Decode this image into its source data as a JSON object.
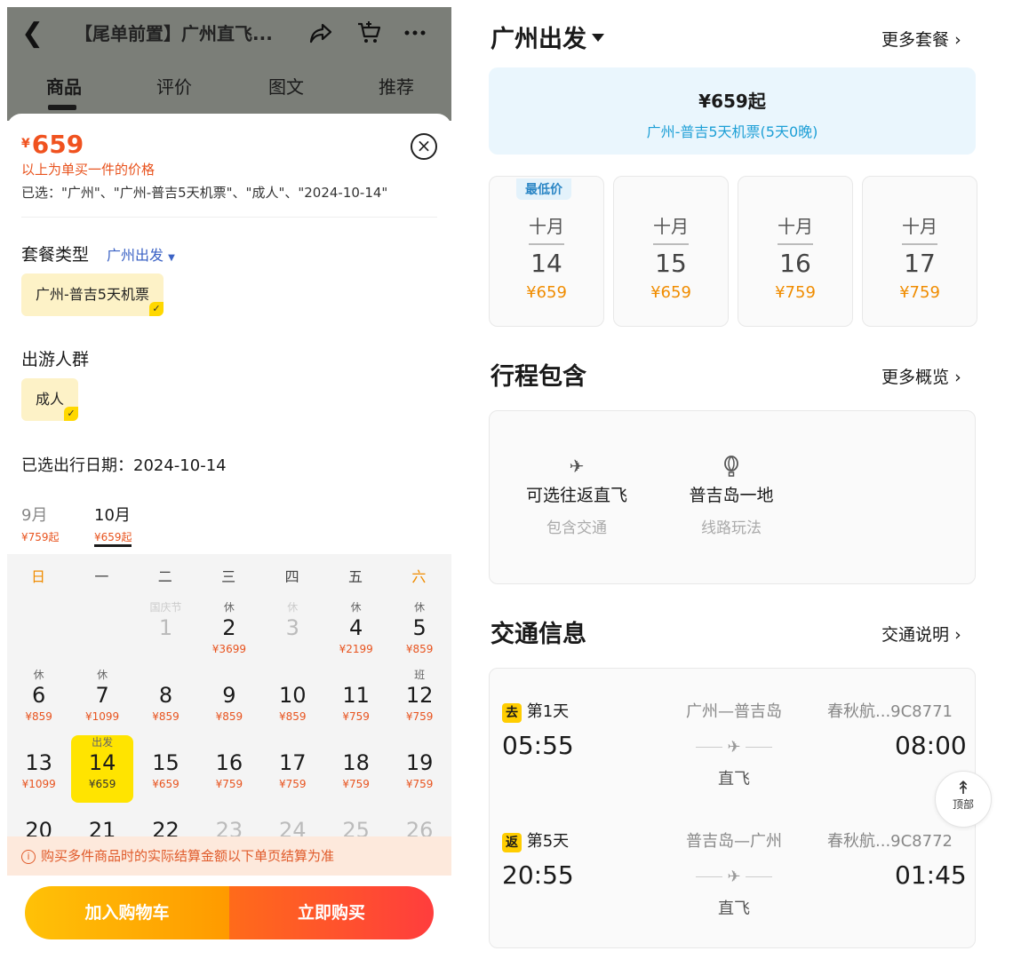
{
  "left": {
    "title": "【尾单前置】广州直飞...",
    "tabs": [
      "商品",
      "评价",
      "图文",
      "推荐"
    ],
    "price_currency": "¥",
    "price": "659",
    "price_note": "以上为单买一件的价格",
    "selected": "已选：\"广州\"、\"广州-普吉5天机票\"、\"成人\"、\"2024-10-14\"",
    "package_label": "套餐类型",
    "package_link": "广州出发",
    "package_chip": "广州-普吉5天机票",
    "crowd_label": "出游人群",
    "crowd_chip": "成人",
    "date_line": "已选出行日期：2024-10-14",
    "months": [
      {
        "name": "9月",
        "price": "¥759起"
      },
      {
        "name": "10月",
        "price": "¥659起"
      }
    ],
    "weekdays": [
      "日",
      "一",
      "二",
      "三",
      "四",
      "五",
      "六"
    ],
    "notice": "购买多件商品时的实际结算金额以下单页结算为准",
    "cart_button": "加入购物车",
    "buy_button": "立即购买"
  },
  "calendar": {
    "rows": [
      [
        {
          "tag": "",
          "num": "",
          "price": ""
        },
        {
          "tag": "",
          "num": "",
          "price": ""
        },
        {
          "tag": "国庆节",
          "num": "1",
          "price": "",
          "dim": true
        },
        {
          "tag": "休",
          "num": "2",
          "price": "¥3699"
        },
        {
          "tag": "休",
          "num": "3",
          "price": "",
          "dim": true
        },
        {
          "tag": "休",
          "num": "4",
          "price": "¥2199"
        },
        {
          "tag": "休",
          "num": "5",
          "price": "¥859"
        }
      ],
      [
        {
          "tag": "休",
          "num": "6",
          "price": "¥859"
        },
        {
          "tag": "休",
          "num": "7",
          "price": "¥1099"
        },
        {
          "tag": "",
          "num": "8",
          "price": "¥859"
        },
        {
          "tag": "",
          "num": "9",
          "price": "¥859"
        },
        {
          "tag": "",
          "num": "10",
          "price": "¥859"
        },
        {
          "tag": "",
          "num": "11",
          "price": "¥759"
        },
        {
          "tag": "班",
          "num": "12",
          "price": "¥759"
        }
      ],
      [
        {
          "tag": "",
          "num": "13",
          "price": "¥1099"
        },
        {
          "tag": "出发",
          "num": "14",
          "price": "¥659",
          "sel": true
        },
        {
          "tag": "",
          "num": "15",
          "price": "¥659"
        },
        {
          "tag": "",
          "num": "16",
          "price": "¥759"
        },
        {
          "tag": "",
          "num": "17",
          "price": "¥759"
        },
        {
          "tag": "",
          "num": "18",
          "price": "¥759"
        },
        {
          "tag": "",
          "num": "19",
          "price": "¥759"
        }
      ],
      [
        {
          "tag": "",
          "num": "20",
          "price": ""
        },
        {
          "tag": "",
          "num": "21",
          "price": ""
        },
        {
          "tag": "",
          "num": "22",
          "price": ""
        },
        {
          "tag": "",
          "num": "23",
          "price": "",
          "dim": true
        },
        {
          "tag": "",
          "num": "24",
          "price": "",
          "dim": true
        },
        {
          "tag": "",
          "num": "25",
          "price": "",
          "dim": true
        },
        {
          "tag": "",
          "num": "26",
          "price": "",
          "dim": true
        }
      ]
    ]
  },
  "right": {
    "depart_title": "广州出发",
    "more_packages": "更多套餐",
    "blue_price": "¥659起",
    "blue_sub": "广州-普吉5天机票(5天0晚)",
    "lowest_tag": "最低价",
    "date_cards": [
      {
        "month": "十月",
        "day": "14",
        "price": "¥659"
      },
      {
        "month": "十月",
        "day": "15",
        "price": "¥659"
      },
      {
        "month": "十月",
        "day": "16",
        "price": "¥759"
      },
      {
        "month": "十月",
        "day": "17",
        "price": "¥759"
      }
    ],
    "itinerary_title": "行程包含",
    "itinerary_more": "更多概览",
    "include_items": [
      {
        "title": "可选往返直飞",
        "sub": "包含交通"
      },
      {
        "title": "普吉岛一地",
        "sub": "线路玩法"
      }
    ],
    "traffic_title": "交通信息",
    "traffic_more": "交通说明",
    "flights": [
      {
        "badge": "去",
        "day": "第1天",
        "route": "广州—普吉岛",
        "airline": "春秋航...9C8771",
        "dep": "05:55",
        "arr": "08:00",
        "direct": "直飞"
      },
      {
        "badge": "返",
        "day": "第5天",
        "route": "普吉岛—广州",
        "airline": "春秋航...9C8772",
        "dep": "20:55",
        "arr": "01:45",
        "direct": "直飞"
      }
    ],
    "top_button": "顶部"
  }
}
